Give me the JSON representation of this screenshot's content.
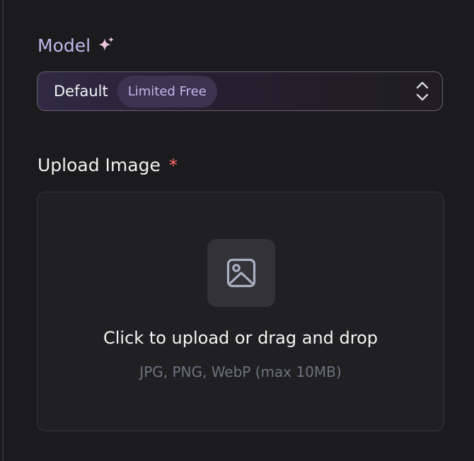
{
  "model": {
    "label": "Model",
    "icon": "sparkles-icon",
    "select": {
      "value": "Default",
      "badge": "Limited Free",
      "icon": "chevron-up-down-icon"
    }
  },
  "upload": {
    "label": "Upload Image",
    "required_marker": "*",
    "dropzone": {
      "icon": "image-icon",
      "title": "Click to upload or drag and drop",
      "subtitle": "JPG, PNG, WebP (max 10MB)"
    }
  },
  "colors": {
    "model_label": "#c3b7ee",
    "badge_background": "#3b3350",
    "badge_text": "#c6b9ef",
    "required": "#ff6b6b",
    "panel_background": "#1b1b1d",
    "dropzone_background": "#202023"
  }
}
